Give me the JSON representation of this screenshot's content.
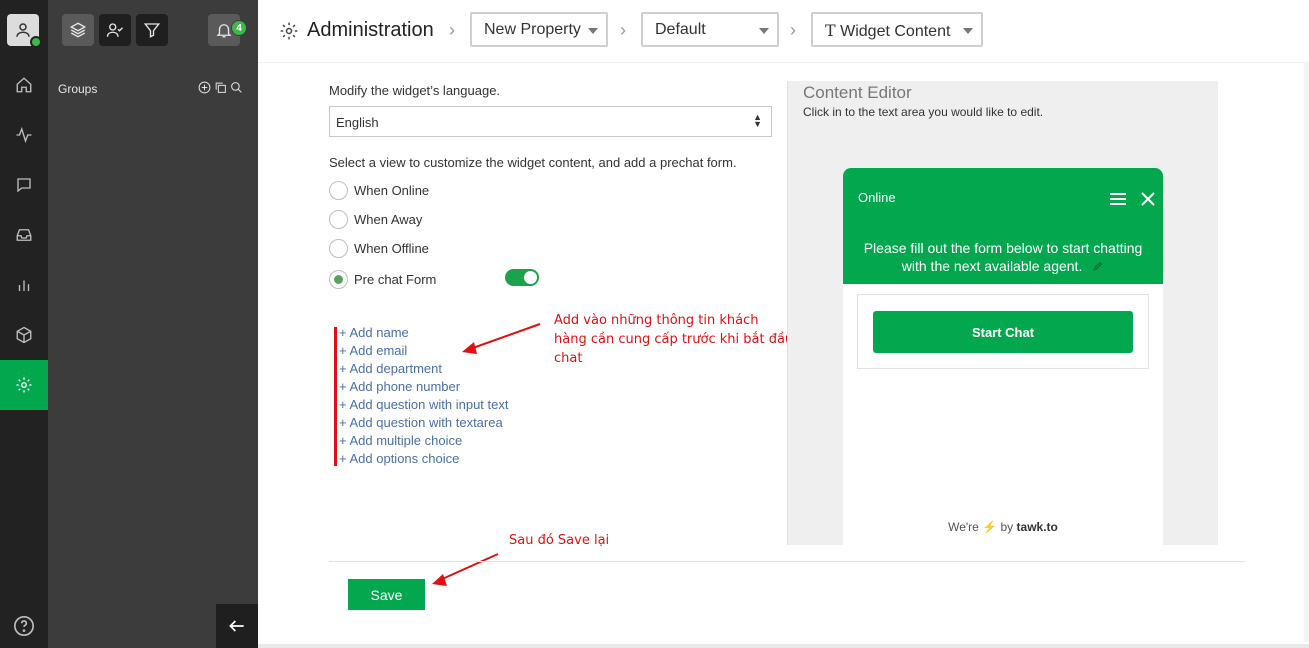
{
  "header": {
    "title": "Administration",
    "property": "New Property",
    "widget": "Default",
    "section": "Widget Content",
    "notification_count": "4"
  },
  "groups_panel": {
    "label": "Groups"
  },
  "form": {
    "language_label": "Modify the widget’s language.",
    "language_value": "English",
    "view_label": "Select a view to customize the widget content, and add a prechat form.",
    "views": [
      "When Online",
      "When Away",
      "When Offline",
      "Pre chat Form"
    ],
    "selected_view": "Pre chat Form",
    "prechat_enabled": true,
    "add_links": [
      "+ Add name",
      "+ Add email",
      "+ Add department",
      "+ Add phone number",
      "+ Add question with input text",
      "+ Add question with textarea",
      "+ Add multiple choice",
      "+ Add options choice"
    ],
    "save_label": "Save"
  },
  "annotations": {
    "fields_note": [
      "Add vào những thông tin khách",
      "hàng cần cung cấp trước khi bắt đầu",
      "chat"
    ],
    "save_note": "Sau đó Save lại"
  },
  "editor": {
    "title": "Content Editor",
    "subtitle": "Click in to the text area you would like to edit.",
    "widget_status": "Online",
    "widget_message": "Please fill out the form below to start chatting with the next available agent.",
    "start_button": "Start Chat",
    "footer_prefix": "We're",
    "footer_by": "by",
    "footer_brand": "tawk.to"
  },
  "colors": {
    "brand_green": "#03a84e",
    "annotation_red": "#e01010",
    "link_blue": "#4a6fa5"
  }
}
